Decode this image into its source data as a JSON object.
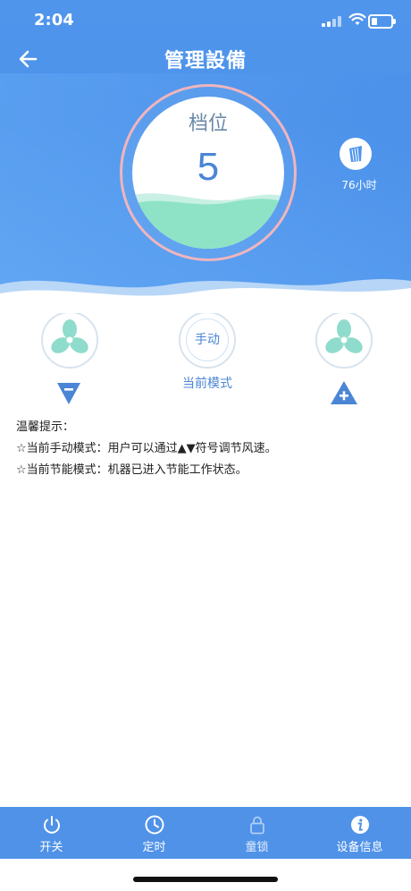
{
  "status": {
    "time": "2:04"
  },
  "header": {
    "title": "管理設備"
  },
  "gauge": {
    "label": "档位",
    "value": "5"
  },
  "timer": {
    "label": "76小时"
  },
  "controls": {
    "mode_label": "手动",
    "mode_caption": "当前模式"
  },
  "tips": {
    "title": "温馨提示：",
    "lines": [
      "☆当前手动模式：用户可以通过▲▼符号调节风速。",
      "☆当前节能模式：机器已进入节能工作状态。"
    ]
  },
  "tabbar": {
    "items": [
      {
        "label": "开关",
        "icon": "power-icon"
      },
      {
        "label": "定时",
        "icon": "clock-icon"
      },
      {
        "label": "童锁",
        "icon": "lock-icon"
      },
      {
        "label": "设备信息",
        "icon": "info-icon"
      }
    ]
  },
  "colors": {
    "header_blue": "#4f95ec",
    "accent_blue": "#4b85d5",
    "wave_green": "#8ee3c6",
    "gauge_ring": "#f0b5bd",
    "fan_mint": "#8fdccc"
  }
}
